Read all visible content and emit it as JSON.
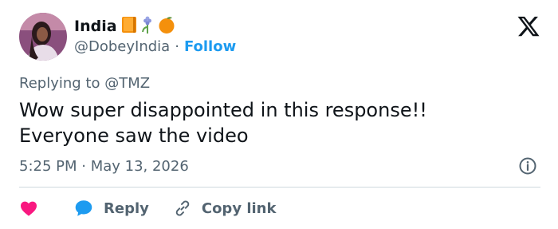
{
  "author": {
    "display_name": "India",
    "handle": "@DobeyIndia",
    "separator": "·",
    "follow_label": "Follow",
    "emojis": [
      "book-emoji",
      "hyacinth-emoji",
      "orange-emoji"
    ]
  },
  "platform": {
    "logo": "x-logo-icon"
  },
  "reply_context": {
    "text": "Replying to @TMZ"
  },
  "tweet": {
    "text": "Wow super disappointed in this response!!\nEveryone saw the video",
    "timestamp": "5:25 PM · May 13, 2026"
  },
  "actions": {
    "like_icon": "heart-icon",
    "reply_label": "Reply",
    "reply_icon": "speech-bubble-icon",
    "copy_label": "Copy link",
    "copy_icon": "link-icon"
  },
  "colors": {
    "link": "#1d9bf0",
    "secondary_text": "#536471",
    "like": "#f91880",
    "divider": "#cfd9de"
  }
}
